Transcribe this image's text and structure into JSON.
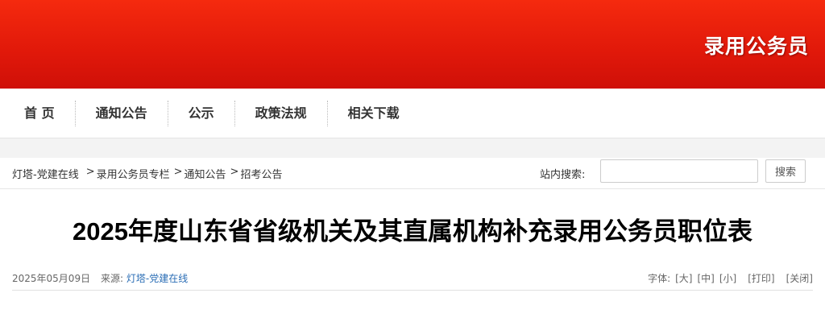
{
  "banner": {
    "title": "录用公务员"
  },
  "nav": {
    "items": [
      {
        "label": "首 页"
      },
      {
        "label": "通知公告"
      },
      {
        "label": "公示"
      },
      {
        "label": "政策法规"
      },
      {
        "label": "相关下载"
      }
    ]
  },
  "breadcrumb": {
    "home": "灯塔-党建在线",
    "sep": ">",
    "items": [
      "录用公务员专栏",
      "通知公告",
      "招考公告"
    ]
  },
  "search": {
    "label": "站内搜索:",
    "value": "",
    "placeholder": "",
    "button_label": "搜索"
  },
  "article": {
    "title": "2025年度山东省省级机关及其直属机构补充录用公务员职位表",
    "date": "2025年05月09日",
    "source_label": "来源:",
    "source": "灯塔-党建在线",
    "tools": {
      "font_label": "字体:",
      "large": "[大]",
      "medium": "[中]",
      "small": "[小]",
      "print": "[打印]",
      "close": "[关闭]"
    }
  },
  "colors": {
    "banner_red": "#e0180a",
    "link_blue": "#2a6db5"
  }
}
